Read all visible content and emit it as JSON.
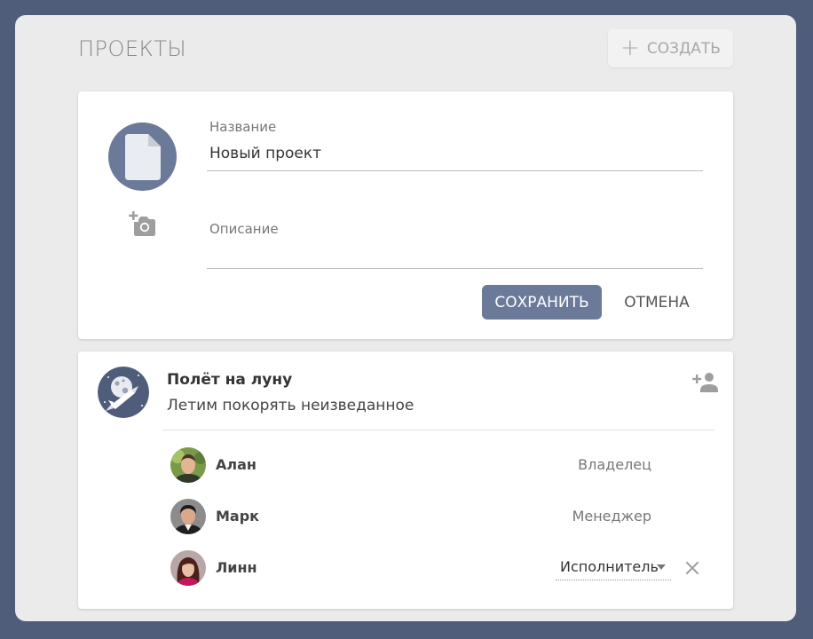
{
  "header": {
    "title": "ПРОЕКТЫ",
    "create_label": "СОЗДАТЬ"
  },
  "new_project_form": {
    "name_label": "Название",
    "name_value": "Новый проект",
    "description_label": "Описание",
    "description_value": "",
    "save_label": "СОХРАНИТЬ",
    "cancel_label": "ОТМЕНА",
    "avatar_icon": "file-icon",
    "upload_icon": "add-photo-icon"
  },
  "project": {
    "name": "Полёт на луну",
    "description": "Летим покорять неизведанное",
    "add_member_icon": "person-add-icon",
    "members": [
      {
        "name": "Алан",
        "role": "Владелец"
      },
      {
        "name": "Марк",
        "role": "Менеджер"
      },
      {
        "name": "Линн",
        "role": "Исполнитель"
      }
    ]
  },
  "colors": {
    "accent": "#6b7a99",
    "background": "#4f5d7a",
    "panel": "#ebebeb"
  }
}
